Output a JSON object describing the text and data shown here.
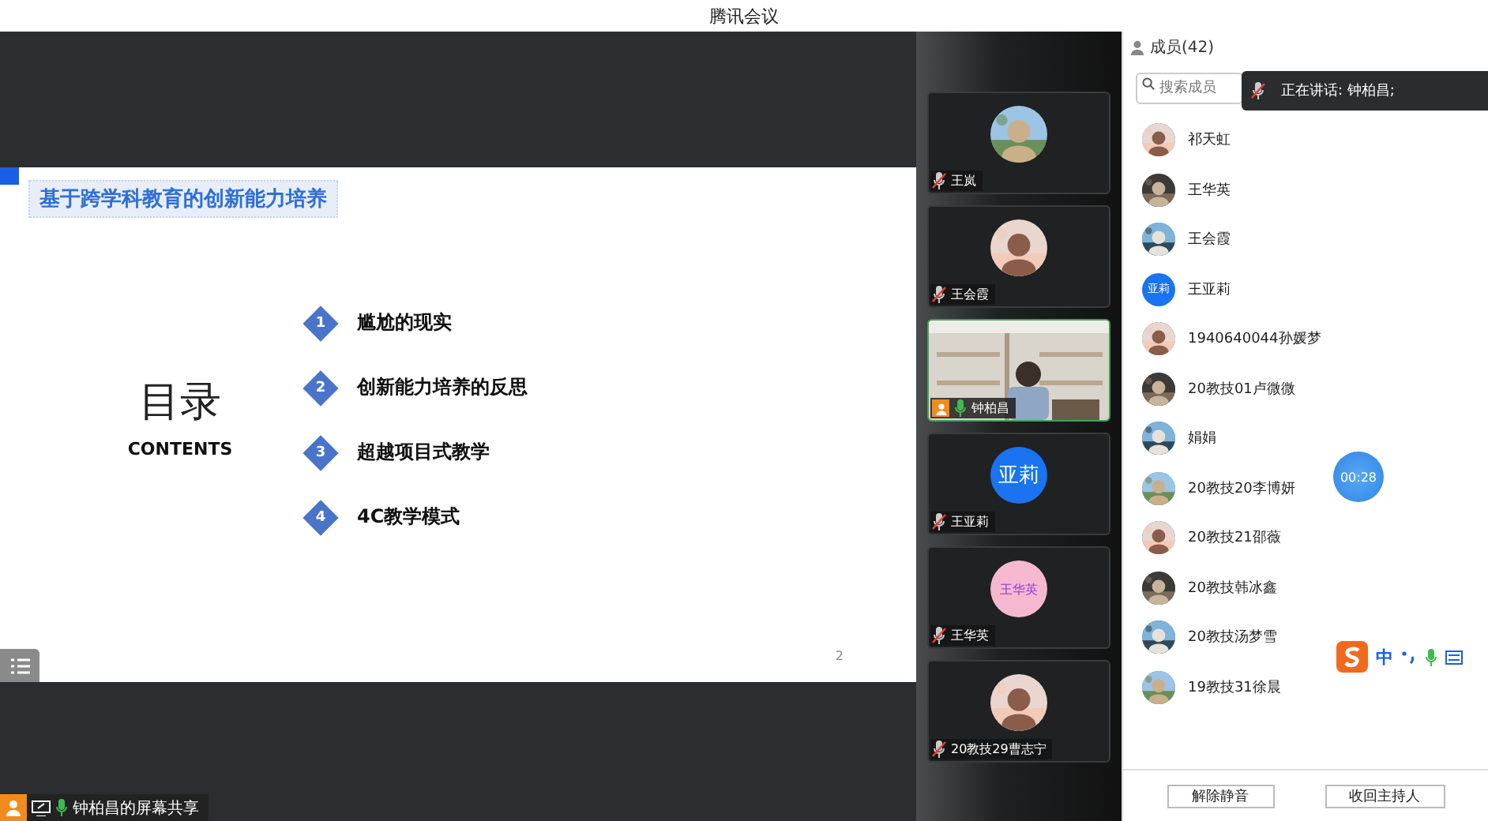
{
  "window": {
    "title": "腾讯会议"
  },
  "slide": {
    "title": "基于跨学科教育的创新能力培养",
    "heading": "目录",
    "subheading": "CONTENTS",
    "page": "2",
    "items": [
      {
        "number": "1",
        "label": "尴尬的现实"
      },
      {
        "number": "2",
        "label": "创新能力培养的反思"
      },
      {
        "number": "3",
        "label": "超越项目式教学"
      },
      {
        "number": "4",
        "label": "4C教学模式"
      }
    ]
  },
  "share_label": {
    "name": "钟柏昌的屏幕共享"
  },
  "video_tiles": [
    {
      "name": "王岚",
      "muted": true,
      "selected": false
    },
    {
      "name": "王会霞",
      "muted": true,
      "selected": false
    },
    {
      "name": "钟柏昌",
      "kind": "video",
      "muted": false,
      "selected": true
    },
    {
      "name": "王亚莉",
      "kind": "text",
      "avatar_text": "亚莉",
      "color": "#1a73f0",
      "muted": true,
      "selected": false
    },
    {
      "name": "王华英",
      "kind": "text",
      "avatar_text": "王华英",
      "color": "#f6b8d0",
      "muted": true,
      "selected": false
    },
    {
      "name": "20教技29曹志宁",
      "muted": true,
      "selected": false
    }
  ],
  "members": {
    "title": "成员(42)",
    "search": {
      "placeholder": "搜索成员"
    },
    "speaking": "正在讲话: 钟柏昌;",
    "timer": "00:28",
    "list": [
      {
        "name": "祁天虹"
      },
      {
        "name": "王华英"
      },
      {
        "name": "王会霞"
      },
      {
        "name": "王亚莉",
        "kind": "text",
        "avatar_text": "亚莉"
      },
      {
        "name": "1940640044孙媛梦"
      },
      {
        "name": "20教技01卢微微"
      },
      {
        "name": "娟娟"
      },
      {
        "name": "20教技20李博妍"
      },
      {
        "name": "20教技21邵薇"
      },
      {
        "name": "20教技韩冰鑫"
      },
      {
        "name": "20教技汤梦雪"
      },
      {
        "name": "19教技31徐晨"
      }
    ],
    "buttons": [
      "解除静音",
      "收回主持人"
    ]
  },
  "ime": {
    "label": "中"
  }
}
